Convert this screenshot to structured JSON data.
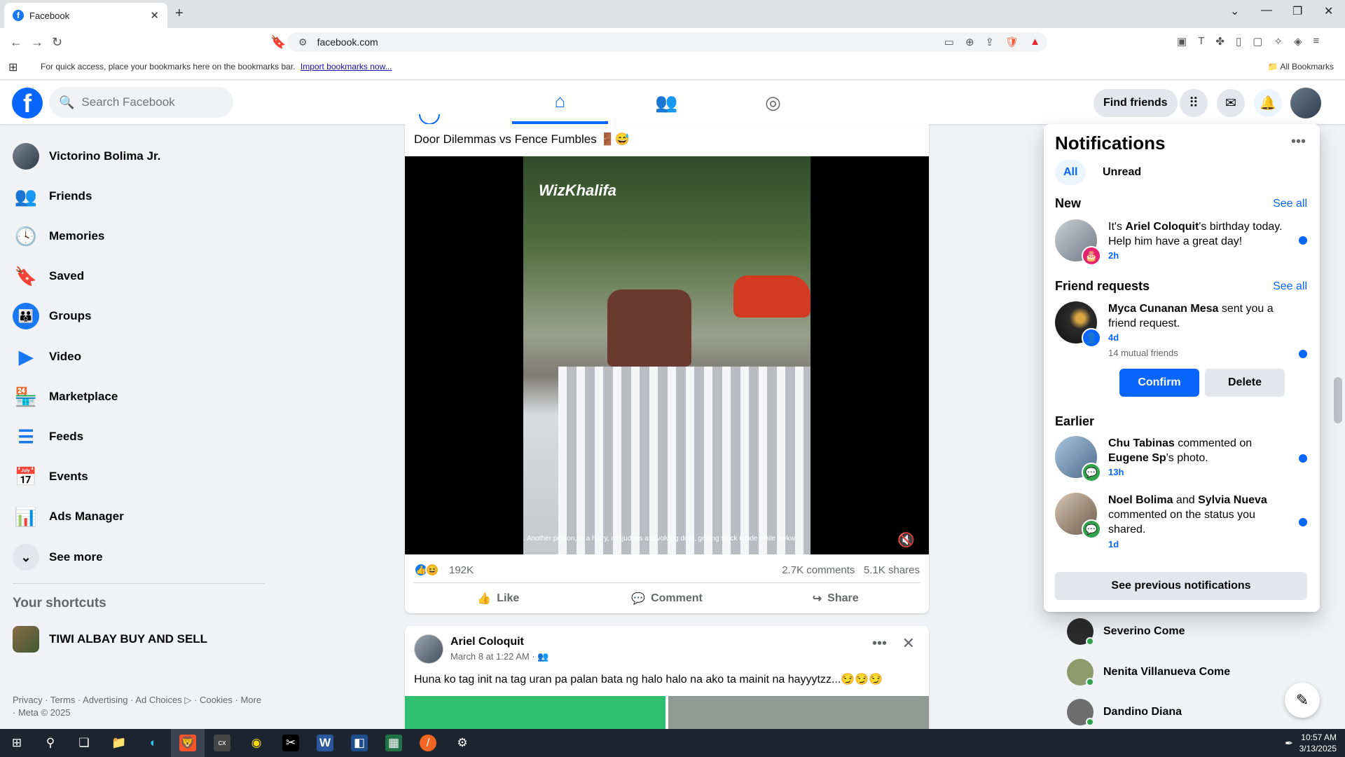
{
  "browser": {
    "tab_title": "Facebook",
    "tab_close": "✕",
    "new_tab": "+",
    "url": "facebook.com",
    "bookmarks_msg": "For quick access, place your bookmarks here on the bookmarks bar.",
    "import_link": "Import bookmarks now...",
    "all_bookmarks": "All Bookmarks"
  },
  "fb_nav": {
    "search_placeholder": "Search Facebook",
    "find_friends": "Find friends"
  },
  "sidebar": {
    "items": [
      {
        "label": "Victorino Bolima Jr."
      },
      {
        "label": "Friends"
      },
      {
        "label": "Memories"
      },
      {
        "label": "Saved"
      },
      {
        "label": "Groups"
      },
      {
        "label": "Video"
      },
      {
        "label": "Marketplace"
      },
      {
        "label": "Feeds"
      },
      {
        "label": "Events"
      },
      {
        "label": "Ads Manager"
      },
      {
        "label": "See more"
      }
    ],
    "shortcuts_title": "Your shortcuts",
    "shortcuts": [
      {
        "label": "TIWI ALBAY BUY AND SELL"
      }
    ],
    "footer": "Privacy · Terms · Advertising · Ad Choices ▷ · Cookies · More · Meta © 2025"
  },
  "post1": {
    "caption": "Door Dilemmas vs Fence Fumbles 🚪😅",
    "video_watermark": "WizKhalifa",
    "video_subtitle": ". Another person, in a hurry, misjudges a revolving door, getting stuck inside while awkw",
    "reactions_count": "192K",
    "comments": "2.7K comments",
    "shares": "5.1K shares",
    "like": "Like",
    "comment": "Comment",
    "share": "Share"
  },
  "post2": {
    "author": "Ariel Coloquit",
    "meta": "March 8 at 1:22 AM · 👥",
    "text": "Huna ko tag init  na tag  uran  pa palan  bata ng halo halo na ako ta mainit  na hayyytzz...😏😏😏"
  },
  "contacts": [
    {
      "name": "Severino Come"
    },
    {
      "name": "Nenita Villanueva Come"
    },
    {
      "name": "Dandino Diana"
    }
  ],
  "notifications": {
    "title": "Notifications",
    "tab_all": "All",
    "tab_unread": "Unread",
    "new_title": "New",
    "see_all": "See all",
    "new_item": {
      "pre": "It's ",
      "name": "Ariel Coloquit",
      "post": "'s birthday today. Help him have a great day!",
      "time": "2h"
    },
    "requests_title": "Friend requests",
    "request": {
      "name": "Myca Cunanan Mesa",
      "post": " sent you a friend request.",
      "time": "4d",
      "mutual": "14 mutual friends",
      "confirm": "Confirm",
      "delete": "Delete"
    },
    "earlier_title": "Earlier",
    "earlier": [
      {
        "name1": "Chu Tabinas",
        "mid": " commented on ",
        "name2": "Eugene Sp",
        "post": "'s photo.",
        "time": "13h"
      },
      {
        "name1": "Noel Bolima",
        "mid": " and ",
        "name2": "Sylvia Nueva",
        "post": " commented on the status you shared.",
        "time": "1d"
      }
    ],
    "see_previous": "See previous notifications"
  },
  "taskbar": {
    "time": "10:57 AM",
    "date": "3/13/2025"
  }
}
